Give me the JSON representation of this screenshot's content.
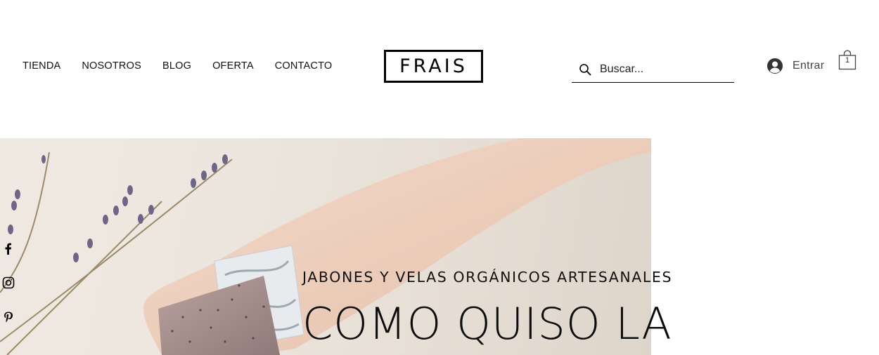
{
  "nav": {
    "items": [
      {
        "label": "TIENDA"
      },
      {
        "label": "NOSOTROS"
      },
      {
        "label": "BLOG"
      },
      {
        "label": "OFERTA"
      },
      {
        "label": "CONTACTO"
      }
    ]
  },
  "logo": {
    "text": "FRAIS"
  },
  "search": {
    "placeholder": "Buscar...",
    "icon": "search-icon"
  },
  "login": {
    "label": "Entrar",
    "icon": "user-avatar-icon"
  },
  "cart": {
    "count": "1",
    "icon": "shopping-bag-icon"
  },
  "social": {
    "icons": [
      "facebook-icon",
      "instagram-icon",
      "pinterest-icon"
    ]
  },
  "hero": {
    "tagline": "JABONES Y VELAS ORGÁNICOS ARTESANALES",
    "headline": "COMO QUISO LA"
  },
  "colors": {
    "text": "#000000",
    "login_text": "#444444",
    "hero_bg": "#ece6de"
  }
}
